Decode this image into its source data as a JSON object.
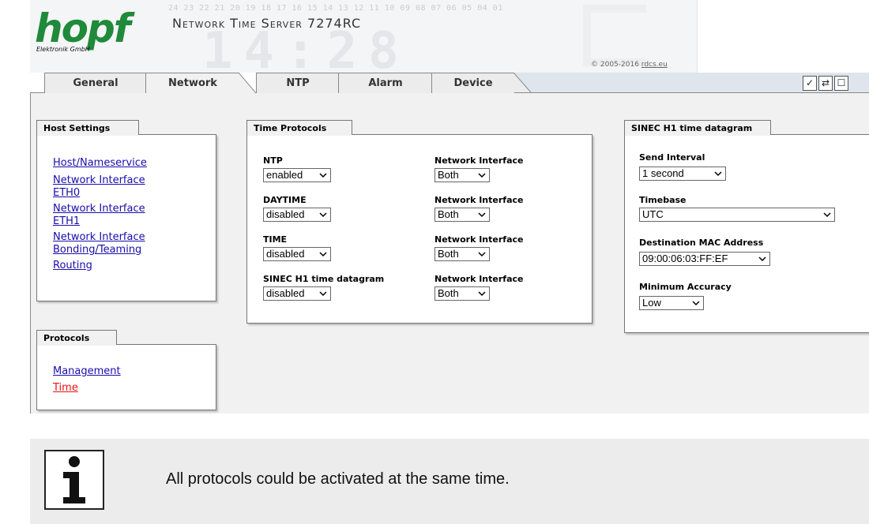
{
  "header": {
    "logo": "hopf",
    "logo_sub": "Elektronik  GmbH",
    "title": "Network Time Server 7274RC",
    "copyright_prefix": "© 2005-2016 ",
    "copyright_link": "rdcs.eu",
    "bg_numbers": "24 23 22 21 20 19 18 17 16 15 14 13 12 11 10 09 08 07 06 05 04 01",
    "bg_digits": "14:28"
  },
  "tabs": [
    {
      "label": "General"
    },
    {
      "label": "Network"
    },
    {
      "label": "NTP"
    },
    {
      "label": "Alarm"
    },
    {
      "label": "Device"
    }
  ],
  "toolbar": {
    "icons": [
      "check-icon",
      "refresh-icon",
      "page-icon"
    ],
    "glyphs": [
      "✓",
      "⇄",
      "☐"
    ]
  },
  "host_settings": {
    "title": "Host Settings",
    "links": [
      "Host/Nameservice",
      "Network Interface ETH0",
      "Network Interface ETH1",
      "Network Interface Bonding/Teaming",
      "Routing"
    ]
  },
  "protocols": {
    "title": "Protocols",
    "links": [
      "Management",
      "Time"
    ]
  },
  "time_protocols": {
    "title": "Time Protocols",
    "rows": [
      {
        "label": "NTP",
        "value": "enabled",
        "iface_label": "Network Interface",
        "iface_value": "Both"
      },
      {
        "label": "DAYTIME",
        "value": "disabled",
        "iface_label": "Network Interface",
        "iface_value": "Both"
      },
      {
        "label": "TIME",
        "value": "disabled",
        "iface_label": "Network Interface",
        "iface_value": "Both"
      },
      {
        "label": "SINEC H1 time datagram",
        "value": "disabled",
        "iface_label": "Network Interface",
        "iface_value": "Both"
      }
    ]
  },
  "sinec": {
    "title": "SINEC H1 time datagram",
    "send_interval_label": "Send Interval",
    "send_interval_value": "1 second",
    "timebase_label": "Timebase",
    "timebase_value": "UTC",
    "dest_mac_label": "Destination MAC Address",
    "dest_mac_value": "09:00:06:03:FF:EF",
    "min_acc_label": "Minimum Accuracy",
    "min_acc_value": "Low"
  },
  "info": {
    "text": "All protocols could be activated at the same time.",
    "icon": "info-icon"
  },
  "colors": {
    "logo_green": "#1f8a3a",
    "link_blue": "#1a0dab",
    "link_active_red": "#ee1111",
    "content_bg": "#f1f1f1",
    "tab_strip_fill": "#dfe5ec"
  }
}
